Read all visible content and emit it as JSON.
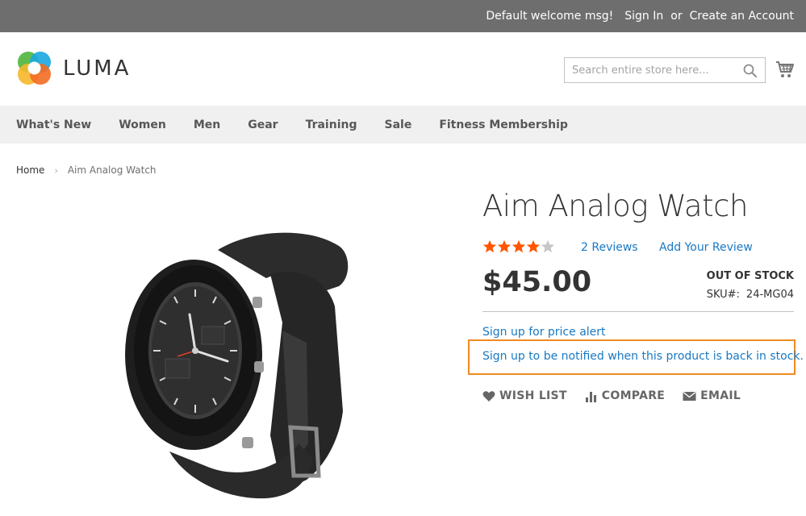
{
  "header": {
    "welcome": "Default welcome msg!",
    "sign_in": "Sign In",
    "or": "or",
    "create_account": "Create an Account",
    "logo_text": "LUMA",
    "search_placeholder": "Search entire store here..."
  },
  "nav": {
    "items": [
      "What's New",
      "Women",
      "Men",
      "Gear",
      "Training",
      "Sale",
      "Fitness Membership"
    ]
  },
  "breadcrumb": {
    "home": "Home",
    "current": "Aim Analog Watch"
  },
  "product": {
    "title": "Aim Analog Watch",
    "rating_out_of_5": 4,
    "reviews_link": "2 Reviews",
    "add_review_link": "Add Your Review",
    "price": "$45.00",
    "stock_status": "OUT OF STOCK",
    "sku_label": "SKU#:",
    "sku_value": "24-MG04",
    "price_alert": "Sign up for price alert",
    "stock_alert": "Sign up to be notified when this product is back in stock.",
    "actions": {
      "wishlist": "WISH LIST",
      "compare": "COMPARE",
      "email": "EMAIL"
    }
  },
  "colors": {
    "top_bar": "#6e6e6e",
    "link": "#1979c3",
    "star": "#ff5501",
    "highlight_border": "#ef8b22",
    "nav_bg": "#f0f0f0"
  },
  "icons": [
    "search-icon",
    "cart-icon",
    "star-icon",
    "heart-icon",
    "compare-icon",
    "envelope-icon",
    "chevron-right-icon"
  ]
}
